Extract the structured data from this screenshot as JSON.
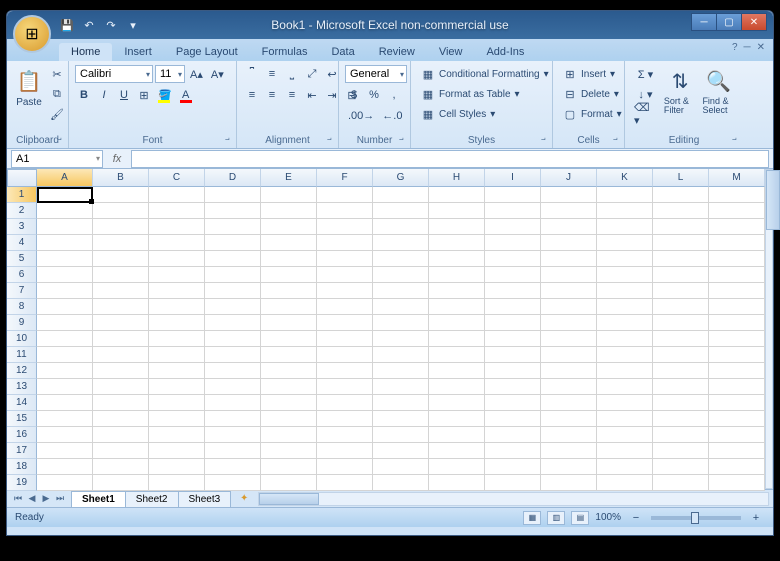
{
  "title": "Book1 - Microsoft Excel non-commercial use",
  "tabs": [
    "Home",
    "Insert",
    "Page Layout",
    "Formulas",
    "Data",
    "Review",
    "View",
    "Add-Ins"
  ],
  "active_tab": 0,
  "ribbon": {
    "clipboard": {
      "label": "Clipboard",
      "paste": "Paste"
    },
    "font": {
      "label": "Font",
      "name": "Calibri",
      "size": "11"
    },
    "alignment": {
      "label": "Alignment"
    },
    "number": {
      "label": "Number",
      "format": "General"
    },
    "styles": {
      "label": "Styles",
      "cond_fmt": "Conditional Formatting",
      "as_table": "Format as Table",
      "cell_styles": "Cell Styles"
    },
    "cells": {
      "label": "Cells",
      "insert": "Insert",
      "delete": "Delete",
      "format": "Format"
    },
    "editing": {
      "label": "Editing",
      "sort": "Sort & Filter",
      "find": "Find & Select"
    }
  },
  "name_box": "A1",
  "columns": [
    "A",
    "B",
    "C",
    "D",
    "E",
    "F",
    "G",
    "H",
    "I",
    "J",
    "K",
    "L",
    "M"
  ],
  "rows": [
    "1",
    "2",
    "3",
    "4",
    "5",
    "6",
    "7",
    "8",
    "9",
    "10",
    "11",
    "12",
    "13",
    "14",
    "15",
    "16",
    "17",
    "18",
    "19"
  ],
  "sheets": [
    "Sheet1",
    "Sheet2",
    "Sheet3"
  ],
  "active_sheet": 0,
  "status": "Ready",
  "zoom": "100%"
}
